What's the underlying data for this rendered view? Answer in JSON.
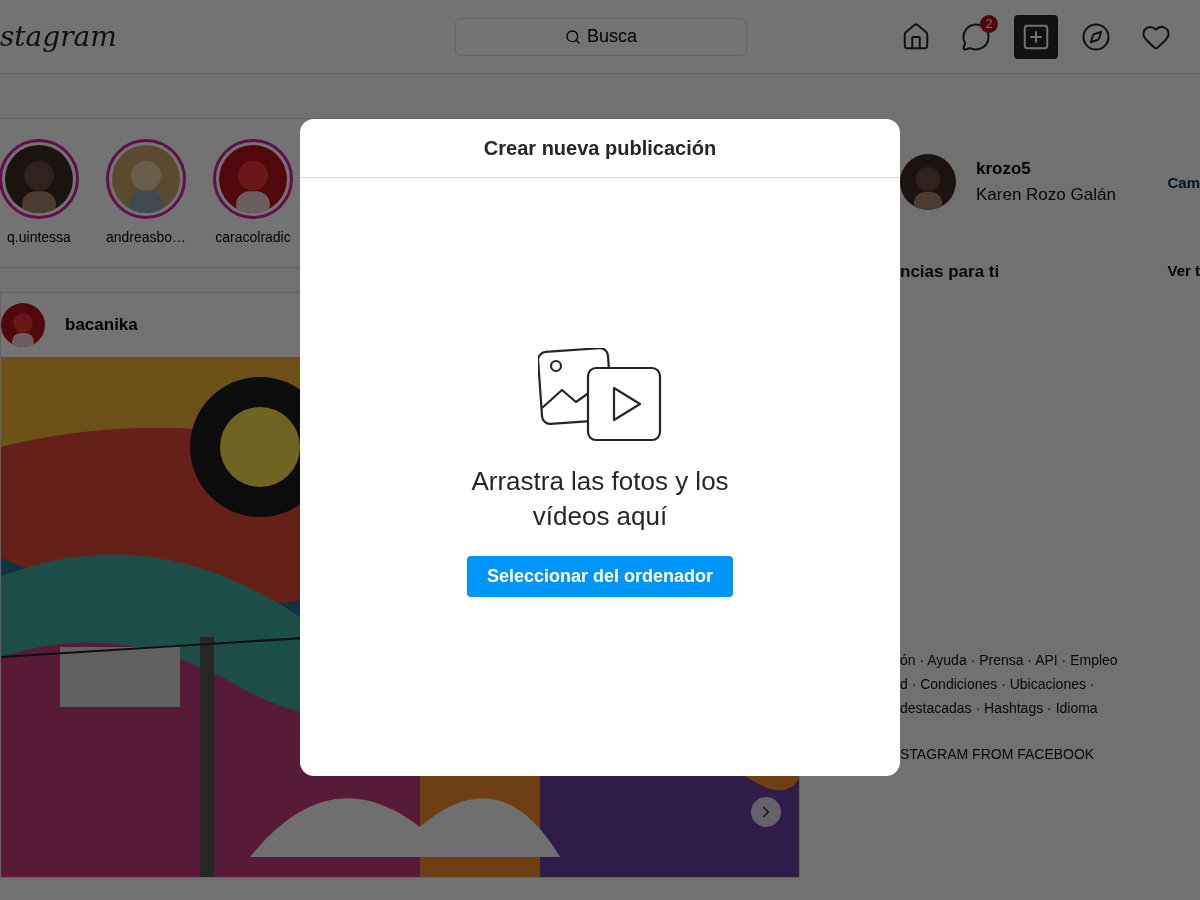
{
  "nav": {
    "logo": "stagram",
    "search": {
      "placeholder": "Busca"
    },
    "icons": [
      {
        "kind": "home",
        "selected": false
      },
      {
        "kind": "messenger",
        "selected": false,
        "badge": "2"
      },
      {
        "kind": "create",
        "selected": true
      },
      {
        "kind": "explore",
        "selected": false
      },
      {
        "kind": "heart",
        "selected": false
      }
    ]
  },
  "stories": [
    {
      "username": "q.uintessa",
      "kind": "picture"
    },
    {
      "username": "andreasbo…",
      "kind": "picture"
    },
    {
      "username": "caracolradic",
      "kind": "picture"
    }
  ],
  "post": {
    "username": "bacanika"
  },
  "sidebar": {
    "username": "krozo5",
    "name": "Karen Rozo Galán",
    "link": "Cam",
    "suggestions_title": "ncias para ti",
    "see_all": "Ver t",
    "footer_lines": [
      "ón · Ayuda · Prensa · API · Empleo",
      "d · Condiciones · Ubicaciones ·",
      "destacadas · Hashtags · Idioma"
    ],
    "copyright": "STAGRAM FROM FACEBOOK"
  },
  "modal": {
    "title": "Crear nueva publicación",
    "message": "Arrastra las fotos y los vídeos aquí",
    "button": "Seleccionar del ordenador"
  }
}
